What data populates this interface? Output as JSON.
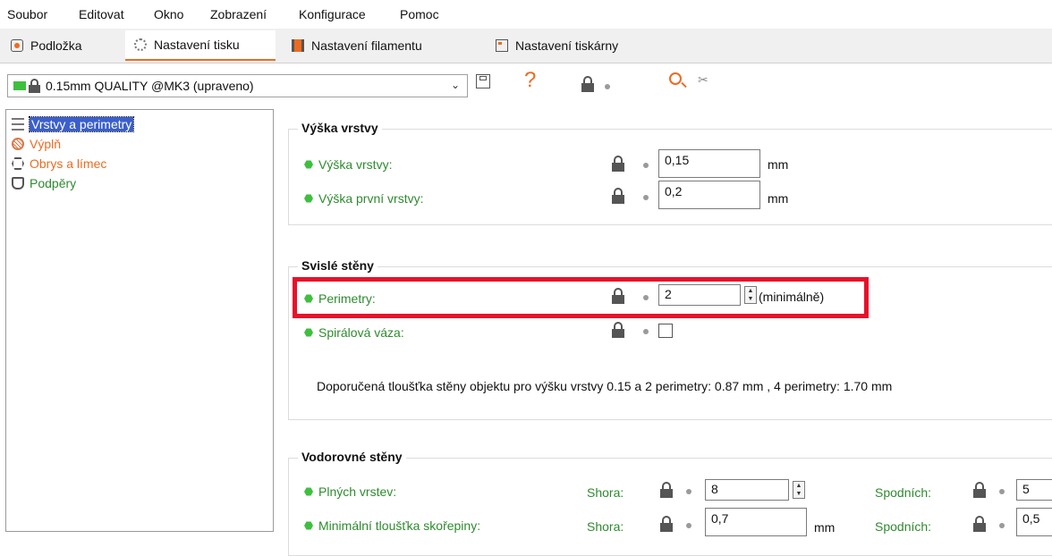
{
  "menu": [
    "Soubor",
    "Editovat",
    "Okno",
    "Zobrazení",
    "Konfigurace",
    "Pomoc"
  ],
  "tabs": [
    {
      "label": "Podložka",
      "icon": "bed-icon"
    },
    {
      "label": "Nastavení tisku",
      "icon": "gear-icon"
    },
    {
      "label": "Nastavení filamentu",
      "icon": "filament-icon"
    },
    {
      "label": "Nastavení tiskárny",
      "icon": "printer-icon"
    }
  ],
  "preset": {
    "name": "0.15mm QUALITY @MK3 (upraveno)",
    "help": "?"
  },
  "tree": [
    {
      "label": "Vrstvy a perimetry",
      "icon": "layers-icon"
    },
    {
      "label": "Výplň",
      "icon": "infill-icon"
    },
    {
      "label": "Obrys a límec",
      "icon": "skirt-icon"
    },
    {
      "label": "Podpěry",
      "icon": "support-icon"
    }
  ],
  "groups": {
    "layer_height": {
      "title": "Výška vrstvy",
      "options": [
        {
          "label": "Výška vrstvy:",
          "value": "0,15",
          "unit": "mm"
        },
        {
          "label": "Výška první vrstvy:",
          "value": "0,2",
          "unit": "mm"
        }
      ]
    },
    "vertical": {
      "title": "Svislé stěny",
      "perimeters": {
        "label": "Perimetry:",
        "value": "2",
        "suffix": "(minimálně)"
      },
      "spiral": {
        "label": "Spirálová váza:"
      },
      "description": "Doporučená tloušťka stěny objektu pro výšku vrstvy 0.15 a 2 perimetry: 0.87 mm , 4 perimetry: 1.70 mm"
    },
    "horizontal": {
      "title": "Vodorovné stěny",
      "solid_layers": {
        "label": "Plných vrstev:",
        "top_label": "Shora:",
        "top_value": "8",
        "bottom_label": "Spodních:",
        "bottom_value": "5"
      },
      "min_shell": {
        "label": "Minimální tloušťka skořepiny:",
        "top_label": "Shora:",
        "top_value": "0,7",
        "unit": "mm",
        "bottom_label": "Spodních:",
        "bottom_value": "0,5"
      }
    }
  },
  "colors": {
    "accent": "#ed6b21",
    "option_green": "#2e8b2e",
    "highlight": "#e8102a",
    "selected": "#3a5fcd"
  }
}
